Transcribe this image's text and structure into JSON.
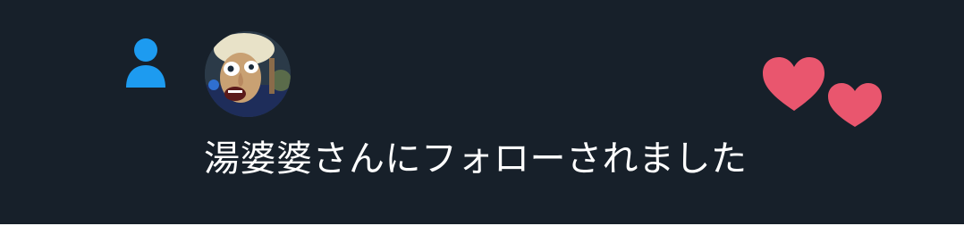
{
  "notification": {
    "type_icon": "person-icon",
    "avatar_icon": "profile-picture",
    "message": "湯婆婆さんにフォローされました",
    "decoration_icon": "hearts-icon"
  },
  "colors": {
    "background": "#17202a",
    "accent": "#1d9bf0",
    "heart": "#e9566e",
    "text": "#ffffff"
  }
}
